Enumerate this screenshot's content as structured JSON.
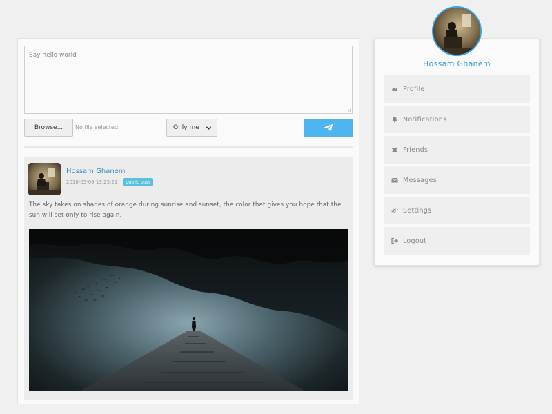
{
  "composer": {
    "placeholder": "Say hello world",
    "browse_label": "Browse...",
    "file_status": "No file selected.",
    "privacy_value": "Only me",
    "send_icon": "paper-plane-icon"
  },
  "post": {
    "author": "Hossam Ghanem",
    "date": "2018-05-09 13:25:21",
    "badge": "public post",
    "text": "The sky takes on shades of orange during sunrise and sunset, the color that gives you hope that the sun will set only to rise again."
  },
  "sidebar": {
    "user_name": "Hossam Ghanem",
    "items": [
      {
        "label": "Profile",
        "icon": "dashboard-icon"
      },
      {
        "label": "Notifications",
        "icon": "bell-icon"
      },
      {
        "label": "Friends",
        "icon": "users-icon"
      },
      {
        "label": "Messages",
        "icon": "envelope-icon"
      },
      {
        "label": "Settings",
        "icon": "cogs-icon"
      },
      {
        "label": "Logout",
        "icon": "sign-out-icon"
      }
    ]
  },
  "colors": {
    "accent": "#4db6f0",
    "name_link": "#2f9fd9",
    "badge": "#5bc0de"
  }
}
